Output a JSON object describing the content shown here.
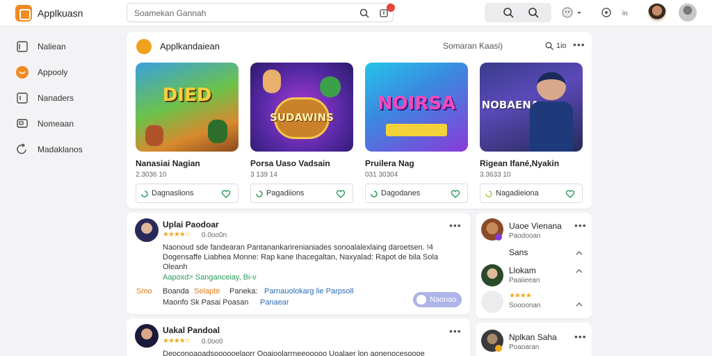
{
  "app": {
    "brand": "Applkuasn"
  },
  "search": {
    "placeholder": "Soamekan Gannah"
  },
  "sidebar": {
    "items": [
      {
        "label": "Naliean",
        "icon": "tablet-icon"
      },
      {
        "label": "Appooly",
        "icon": "apps-icon"
      },
      {
        "label": "Nanaders",
        "icon": "box-icon"
      },
      {
        "label": "Nomeaan",
        "icon": "screen-icon"
      },
      {
        "label": "Madaklanos",
        "icon": "refresh-icon"
      }
    ]
  },
  "featured": {
    "title": "Applkandaiean",
    "subtitle": "Somaran Kaasi)",
    "filter_label": "1io",
    "apps": [
      {
        "name": "Nanasiai Nagian",
        "meta": "2.3036 10",
        "button": "Dagnaslions",
        "art": "DIED"
      },
      {
        "name": "Porsa Uaso Vadsain",
        "meta": "3 139 14",
        "button": "Pagadiions",
        "art": "SUDAWINS"
      },
      {
        "name": "Pruilera Nag",
        "meta": "031 30304",
        "button": "Dagodanes",
        "art": "NOIRSA"
      },
      {
        "name": "Rigean Ifané,Nyakin",
        "meta": "3.3633 10",
        "button": "Nagadieiona",
        "art": "NOBAENA"
      }
    ]
  },
  "reviews": [
    {
      "name": "Uplai Paodoar",
      "stars": "★★★★☆",
      "meta": "0.0oo0n",
      "text": "Naonoud sde fandearan Pantanankarirenianiades sonoalalexlaing daroetsen.  !4 Dogensaffe Liabhea Monne: Rap kane Ihacegaltan, Naxyalad: Rapot de bila Sola Oleanh",
      "link": "Aapoxd> Sanganceiay, Bi-v",
      "tag1": "Smo",
      "tag2": "Boanda",
      "tag3": "Selapte",
      "tag4": "Paneka:",
      "tag5": "Parnauolokarg lie Parpsoll",
      "line3a": "Maonfo Sk Pasai Poasan",
      "line3b": "Panaear",
      "reply": "Naonao"
    },
    {
      "name": "Uakal Pandoal",
      "stars": "★★★★☆",
      "meta": "0.0oo0",
      "text": "Deoconoaoadsoooooelaorr Ooaioolarrneeooooo Uoalaer lon aonenocesoooe"
    }
  ],
  "right_panel": {
    "items": [
      {
        "name": "Uaoe Vienana",
        "sub": "Paodooan"
      },
      {
        "name": "Sans",
        "sub": ""
      },
      {
        "name": "Llokam",
        "sub": "Paaiieean"
      },
      {
        "name": "",
        "sub": "Soooonan",
        "stars": "★★★★"
      }
    ],
    "bottom": {
      "name": "Nplkan Saha",
      "sub": "Poaoaran"
    }
  },
  "colors": {
    "accent": "#f28a22",
    "link": "#2a9a5a",
    "star": "#f2a91d",
    "badge": "#e5483a"
  }
}
